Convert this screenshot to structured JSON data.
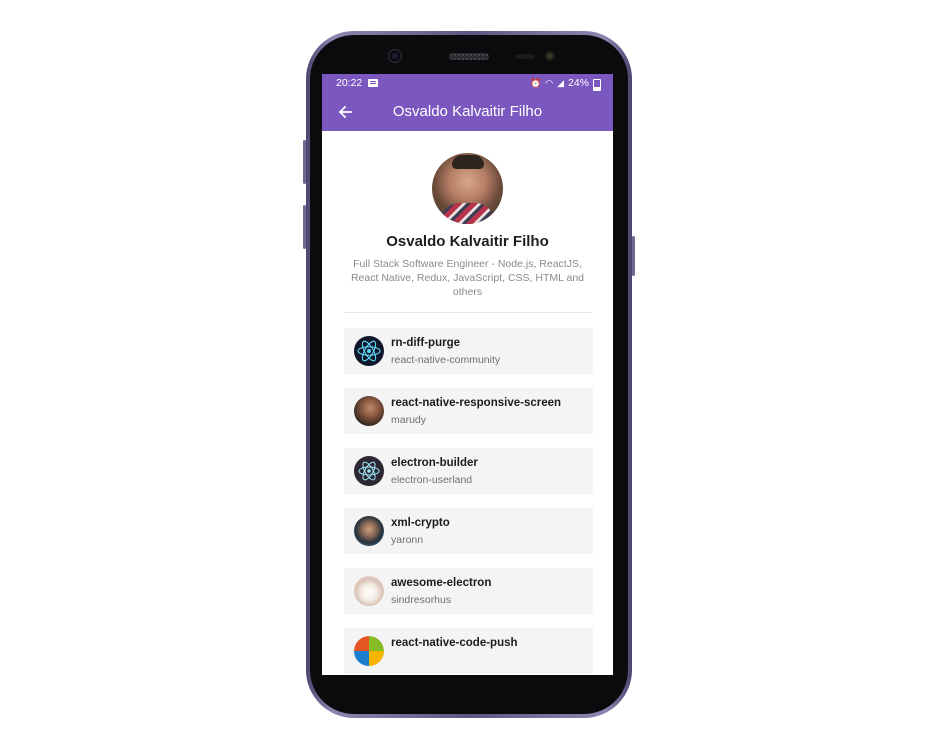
{
  "status_bar": {
    "time": "20:22",
    "battery": "24%"
  },
  "app_bar": {
    "title": "Osvaldo Kalvaitir Filho",
    "back_icon": "arrow-left-icon"
  },
  "profile": {
    "name": "Osvaldo Kalvaitir Filho",
    "bio": "Full Stack Software Engineer - Node.js, ReactJS, React Native, Redux, JavaScript, CSS, HTML and others"
  },
  "repos": [
    {
      "name": "rn-diff-purge",
      "owner": "react-native-community"
    },
    {
      "name": "react-native-responsive-screen",
      "owner": "marudy"
    },
    {
      "name": "electron-builder",
      "owner": "electron-userland"
    },
    {
      "name": "xml-crypto",
      "owner": "yaronn"
    },
    {
      "name": "awesome-electron",
      "owner": "sindresorhus"
    },
    {
      "name": "react-native-code-push",
      "owner": ""
    }
  ],
  "colors": {
    "accent": "#7a58bf",
    "card_bg": "#f4f4f4"
  }
}
